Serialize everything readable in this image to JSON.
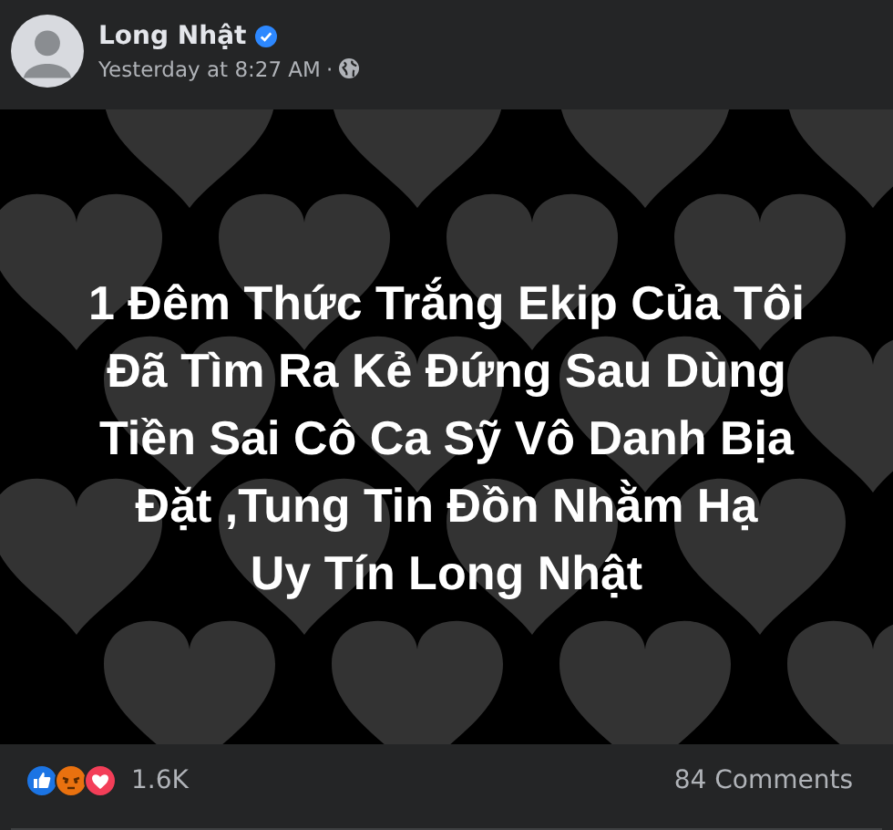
{
  "post": {
    "author": "Long Nhật",
    "verified": true,
    "time": "Yesterday at 8:27 AM",
    "separator": "·"
  },
  "content": {
    "text": "1 Đêm Thức Trắng Ekip Của Tôi\nĐã Tìm Ra Kẻ Đứng Sau Dùng\nTiền Sai Cô Ca Sỹ Vô Danh Bịa\nĐặt ,Tung Tin Đồn Nhằm Hạ\nUy Tín Long Nhật"
  },
  "footer": {
    "reactions": [
      {
        "kind": "like"
      },
      {
        "kind": "angry"
      },
      {
        "kind": "love"
      }
    ],
    "reaction_count": "1.6K",
    "comments": "84 Comments"
  }
}
